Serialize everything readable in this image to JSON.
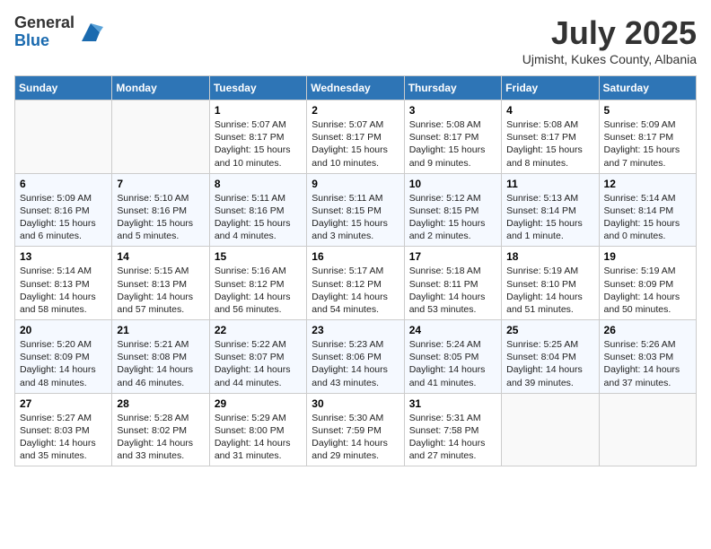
{
  "logo": {
    "general": "General",
    "blue": "Blue"
  },
  "title": "July 2025",
  "location": "Ujmisht, Kukes County, Albania",
  "days_of_week": [
    "Sunday",
    "Monday",
    "Tuesday",
    "Wednesday",
    "Thursday",
    "Friday",
    "Saturday"
  ],
  "weeks": [
    [
      {
        "day": "",
        "info": ""
      },
      {
        "day": "",
        "info": ""
      },
      {
        "day": "1",
        "info": "Sunrise: 5:07 AM\nSunset: 8:17 PM\nDaylight: 15 hours and 10 minutes."
      },
      {
        "day": "2",
        "info": "Sunrise: 5:07 AM\nSunset: 8:17 PM\nDaylight: 15 hours and 10 minutes."
      },
      {
        "day": "3",
        "info": "Sunrise: 5:08 AM\nSunset: 8:17 PM\nDaylight: 15 hours and 9 minutes."
      },
      {
        "day": "4",
        "info": "Sunrise: 5:08 AM\nSunset: 8:17 PM\nDaylight: 15 hours and 8 minutes."
      },
      {
        "day": "5",
        "info": "Sunrise: 5:09 AM\nSunset: 8:17 PM\nDaylight: 15 hours and 7 minutes."
      }
    ],
    [
      {
        "day": "6",
        "info": "Sunrise: 5:09 AM\nSunset: 8:16 PM\nDaylight: 15 hours and 6 minutes."
      },
      {
        "day": "7",
        "info": "Sunrise: 5:10 AM\nSunset: 8:16 PM\nDaylight: 15 hours and 5 minutes."
      },
      {
        "day": "8",
        "info": "Sunrise: 5:11 AM\nSunset: 8:16 PM\nDaylight: 15 hours and 4 minutes."
      },
      {
        "day": "9",
        "info": "Sunrise: 5:11 AM\nSunset: 8:15 PM\nDaylight: 15 hours and 3 minutes."
      },
      {
        "day": "10",
        "info": "Sunrise: 5:12 AM\nSunset: 8:15 PM\nDaylight: 15 hours and 2 minutes."
      },
      {
        "day": "11",
        "info": "Sunrise: 5:13 AM\nSunset: 8:14 PM\nDaylight: 15 hours and 1 minute."
      },
      {
        "day": "12",
        "info": "Sunrise: 5:14 AM\nSunset: 8:14 PM\nDaylight: 15 hours and 0 minutes."
      }
    ],
    [
      {
        "day": "13",
        "info": "Sunrise: 5:14 AM\nSunset: 8:13 PM\nDaylight: 14 hours and 58 minutes."
      },
      {
        "day": "14",
        "info": "Sunrise: 5:15 AM\nSunset: 8:13 PM\nDaylight: 14 hours and 57 minutes."
      },
      {
        "day": "15",
        "info": "Sunrise: 5:16 AM\nSunset: 8:12 PM\nDaylight: 14 hours and 56 minutes."
      },
      {
        "day": "16",
        "info": "Sunrise: 5:17 AM\nSunset: 8:12 PM\nDaylight: 14 hours and 54 minutes."
      },
      {
        "day": "17",
        "info": "Sunrise: 5:18 AM\nSunset: 8:11 PM\nDaylight: 14 hours and 53 minutes."
      },
      {
        "day": "18",
        "info": "Sunrise: 5:19 AM\nSunset: 8:10 PM\nDaylight: 14 hours and 51 minutes."
      },
      {
        "day": "19",
        "info": "Sunrise: 5:19 AM\nSunset: 8:09 PM\nDaylight: 14 hours and 50 minutes."
      }
    ],
    [
      {
        "day": "20",
        "info": "Sunrise: 5:20 AM\nSunset: 8:09 PM\nDaylight: 14 hours and 48 minutes."
      },
      {
        "day": "21",
        "info": "Sunrise: 5:21 AM\nSunset: 8:08 PM\nDaylight: 14 hours and 46 minutes."
      },
      {
        "day": "22",
        "info": "Sunrise: 5:22 AM\nSunset: 8:07 PM\nDaylight: 14 hours and 44 minutes."
      },
      {
        "day": "23",
        "info": "Sunrise: 5:23 AM\nSunset: 8:06 PM\nDaylight: 14 hours and 43 minutes."
      },
      {
        "day": "24",
        "info": "Sunrise: 5:24 AM\nSunset: 8:05 PM\nDaylight: 14 hours and 41 minutes."
      },
      {
        "day": "25",
        "info": "Sunrise: 5:25 AM\nSunset: 8:04 PM\nDaylight: 14 hours and 39 minutes."
      },
      {
        "day": "26",
        "info": "Sunrise: 5:26 AM\nSunset: 8:03 PM\nDaylight: 14 hours and 37 minutes."
      }
    ],
    [
      {
        "day": "27",
        "info": "Sunrise: 5:27 AM\nSunset: 8:03 PM\nDaylight: 14 hours and 35 minutes."
      },
      {
        "day": "28",
        "info": "Sunrise: 5:28 AM\nSunset: 8:02 PM\nDaylight: 14 hours and 33 minutes."
      },
      {
        "day": "29",
        "info": "Sunrise: 5:29 AM\nSunset: 8:00 PM\nDaylight: 14 hours and 31 minutes."
      },
      {
        "day": "30",
        "info": "Sunrise: 5:30 AM\nSunset: 7:59 PM\nDaylight: 14 hours and 29 minutes."
      },
      {
        "day": "31",
        "info": "Sunrise: 5:31 AM\nSunset: 7:58 PM\nDaylight: 14 hours and 27 minutes."
      },
      {
        "day": "",
        "info": ""
      },
      {
        "day": "",
        "info": ""
      }
    ]
  ]
}
